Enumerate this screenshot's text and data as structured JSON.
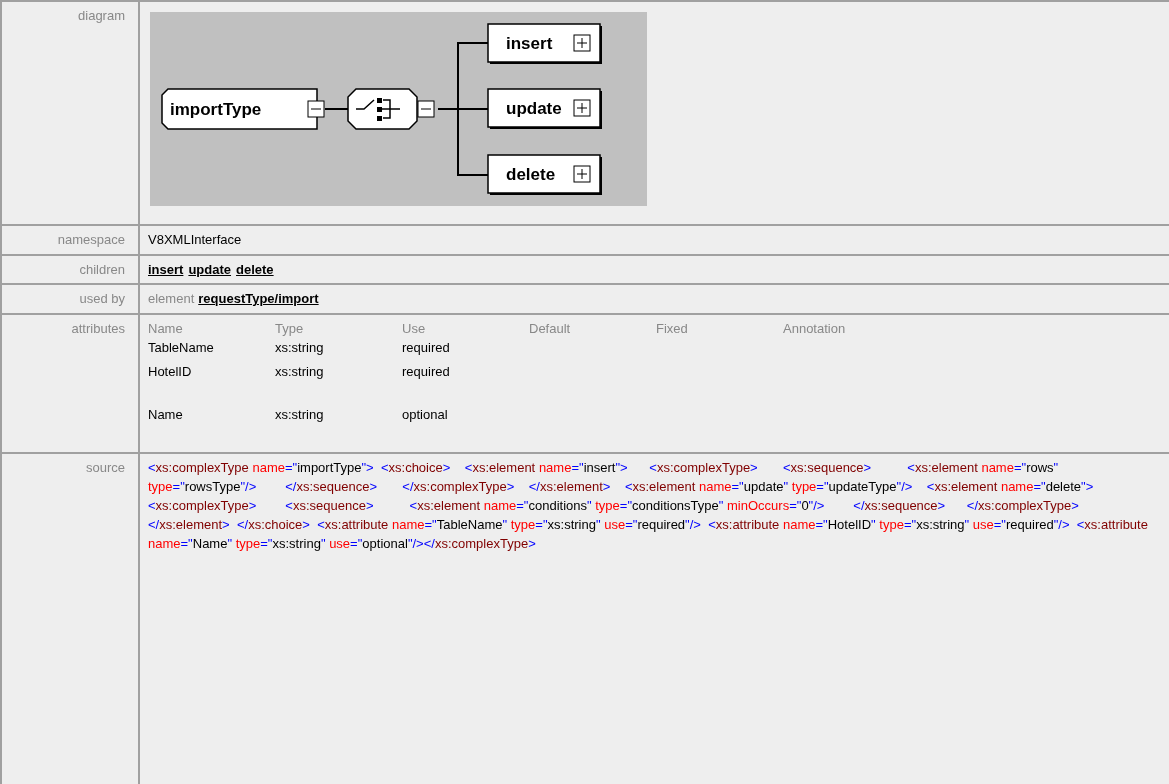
{
  "diagram_row": {
    "label": "diagram",
    "root": {
      "name": "importType",
      "expanded": true
    },
    "compositor": {
      "kind": "choice",
      "expanded": true
    },
    "children": [
      {
        "name": "insert",
        "expanded": false
      },
      {
        "name": "update",
        "expanded": false
      },
      {
        "name": "delete",
        "expanded": false
      }
    ]
  },
  "namespace": {
    "label": "namespace",
    "value": "V8XMLInterface"
  },
  "children_row": {
    "label": "children",
    "links": [
      "insert",
      "update",
      "delete"
    ]
  },
  "used_by": {
    "label": "used by",
    "prefix": "element",
    "link": "requestType/import"
  },
  "attributes": {
    "label": "attributes",
    "columns": [
      "Name",
      "Type",
      "Use",
      "Default",
      "Fixed",
      "Annotation"
    ],
    "rows": [
      [
        "TableName",
        "xs:string",
        "required"
      ],
      [
        "HotelID",
        "xs:string",
        "required"
      ],
      [
        "Name",
        "xs:string",
        "optional"
      ]
    ]
  },
  "source": {
    "label": "source",
    "code": "<xs:complexType name=\"importType\">  <xs:choice>    <xs:element name=\"insert\">      <xs:complexType>       <xs:sequence>          <xs:element name=\"rows\" type=\"rowsType\"/>        </xs:sequence>       </xs:complexType>    </xs:element>    <xs:element name=\"update\" type=\"updateType\"/>    <xs:element name=\"delete\">      <xs:complexType>        <xs:sequence>          <xs:element name=\"conditions\" type=\"conditionsType\" minOccurs=\"0\"/>        </xs:sequence>      </xs:complexType>    </xs:element>  </xs:choice>  <xs:attribute name=\"TableName\" type=\"xs:string\" use=\"required\"/>  <xs:attribute name=\"HotelID\" type=\"xs:string\" use=\"required\"/>  <xs:attribute name=\"Name\" type=\"xs:string\" use=\"optional\"/></xs:complexType>"
  }
}
